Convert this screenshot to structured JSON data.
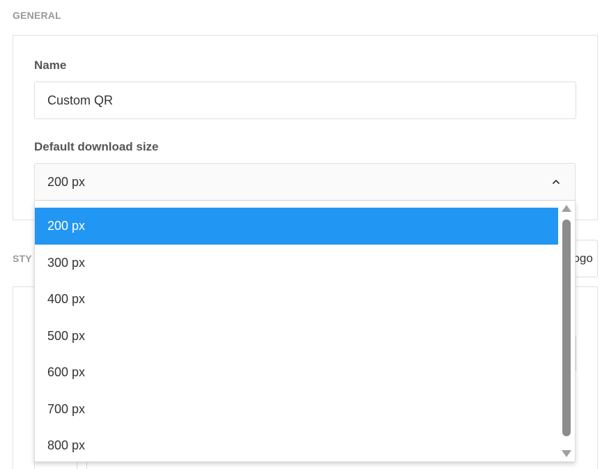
{
  "general": {
    "section_title": "GENERAL",
    "name_label": "Name",
    "name_value": "Custom QR",
    "size_label": "Default download size",
    "size_value": "200 px",
    "size_options": [
      "200 px",
      "300 px",
      "400 px",
      "500 px",
      "600 px",
      "700 px",
      "800 px"
    ],
    "selected_index": 0
  },
  "style": {
    "section_title_partial": "STY",
    "logo_button_partial": "Logo"
  },
  "colors": {
    "selected_option_bg": "#2196f3",
    "section_title": "#999999"
  },
  "icons": {
    "select_chevron": "chevron-up-icon"
  }
}
